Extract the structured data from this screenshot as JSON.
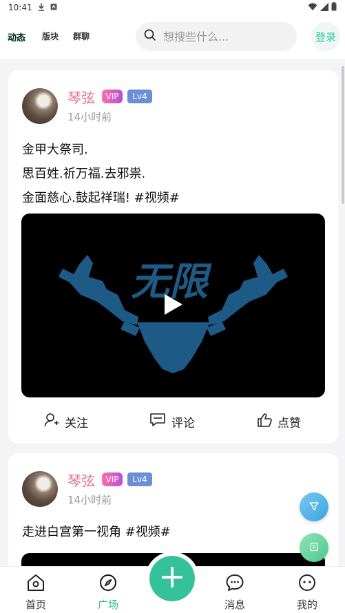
{
  "status_bar": {
    "time": "10:41"
  },
  "top_tabs": [
    {
      "label": "动态",
      "active": true
    },
    {
      "label": "版块",
      "active": false
    },
    {
      "label": "群聊",
      "active": false
    }
  ],
  "search": {
    "placeholder": "想搜些什么..."
  },
  "login_label": "登录",
  "posts": [
    {
      "username": "琴弦",
      "vip_badge": "VIP",
      "level_badge": "Lv4",
      "time": "14小时前",
      "lines": [
        "金甲大祭司.",
        "思百姓.祈万福.去邪祟.",
        "金面慈心.鼓起祥瑞! #视频#"
      ],
      "video_logo_text": "无限",
      "actions": {
        "follow": "关注",
        "comment": "评论",
        "like": "点赞"
      }
    },
    {
      "username": "琴弦",
      "vip_badge": "VIP",
      "level_badge": "Lv4",
      "time": "14小时前",
      "lines": [
        "走进白宫第一视角 #视频#"
      ]
    }
  ],
  "bottom_nav": [
    {
      "label": "首页",
      "icon": "home-icon",
      "active": false
    },
    {
      "label": "广场",
      "icon": "compass-icon",
      "active": true
    },
    {
      "label": "消息",
      "icon": "chat-icon",
      "active": false
    },
    {
      "label": "我的",
      "icon": "profile-icon",
      "active": false
    }
  ],
  "colors": {
    "accent": "#35c29a",
    "username": "#e56d9b",
    "level": "#6a8fd4"
  }
}
